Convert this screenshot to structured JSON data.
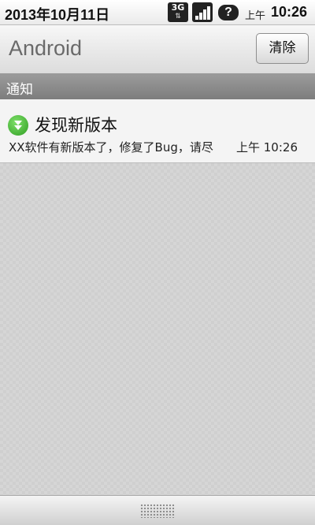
{
  "status_bar": {
    "date": "2013年10月11日",
    "network_label": "3G",
    "ampm": "上午",
    "time": "10:26",
    "icons": [
      "3g-icon",
      "signal-icon",
      "help-icon"
    ]
  },
  "header": {
    "title": "Android",
    "clear_label": "清除"
  },
  "section": {
    "label": "通知"
  },
  "notification": {
    "icon": "download-icon",
    "title": "发现新版本",
    "text": "XX软件有新版本了，修复了Bug，请尽快更新",
    "time": "上午 10:26"
  },
  "colors": {
    "section_bg": "#8a8a8a",
    "download_icon": "#3cae2a"
  }
}
